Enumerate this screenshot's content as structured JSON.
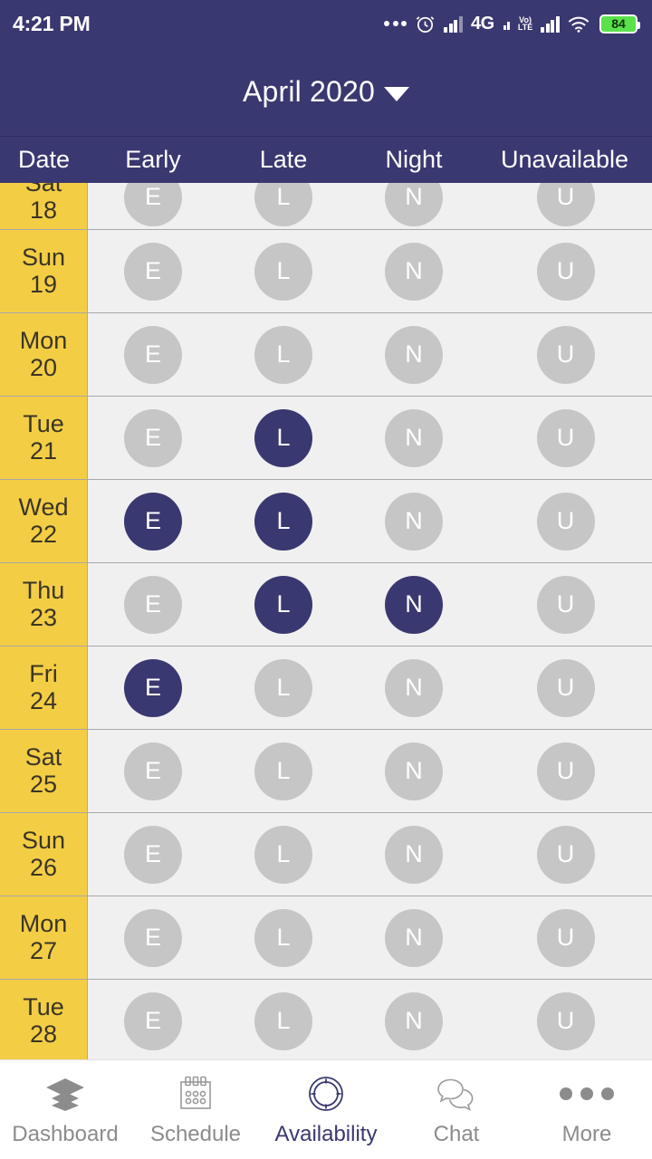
{
  "status_bar": {
    "time": "4:21 PM",
    "icons": [
      "more-dots",
      "alarm-clock",
      "signal-weak",
      "4g",
      "volte",
      "signal-full",
      "wifi",
      "battery"
    ],
    "network_label": "4G",
    "volte_top": "Vo)",
    "volte_bottom": "LTE",
    "battery_percent": "84"
  },
  "title_bar": {
    "month": "April 2020",
    "dropdown_icon": "chevron-down-icon"
  },
  "table": {
    "headers": [
      "Date",
      "Early",
      "Late",
      "Night",
      "Unavailable"
    ],
    "slot_letters": [
      "E",
      "L",
      "N",
      "U"
    ],
    "rows": [
      {
        "dow": "Sat",
        "day": "18",
        "clipped": true,
        "selected": [
          false,
          false,
          false,
          false
        ]
      },
      {
        "dow": "Sun",
        "day": "19",
        "clipped": false,
        "selected": [
          false,
          false,
          false,
          false
        ]
      },
      {
        "dow": "Mon",
        "day": "20",
        "clipped": false,
        "selected": [
          false,
          false,
          false,
          false
        ]
      },
      {
        "dow": "Tue",
        "day": "21",
        "clipped": false,
        "selected": [
          false,
          true,
          false,
          false
        ]
      },
      {
        "dow": "Wed",
        "day": "22",
        "clipped": false,
        "selected": [
          true,
          true,
          false,
          false
        ]
      },
      {
        "dow": "Thu",
        "day": "23",
        "clipped": false,
        "selected": [
          false,
          true,
          true,
          false
        ]
      },
      {
        "dow": "Fri",
        "day": "24",
        "clipped": false,
        "selected": [
          true,
          false,
          false,
          false
        ]
      },
      {
        "dow": "Sat",
        "day": "25",
        "clipped": false,
        "selected": [
          false,
          false,
          false,
          false
        ]
      },
      {
        "dow": "Sun",
        "day": "26",
        "clipped": false,
        "selected": [
          false,
          false,
          false,
          false
        ]
      },
      {
        "dow": "Mon",
        "day": "27",
        "clipped": false,
        "selected": [
          false,
          false,
          false,
          false
        ]
      },
      {
        "dow": "Tue",
        "day": "28",
        "clipped": false,
        "selected": [
          false,
          false,
          false,
          false
        ]
      }
    ]
  },
  "bottom_nav": {
    "active_index": 2,
    "items": [
      {
        "label": "Dashboard",
        "icon": "layers-icon"
      },
      {
        "label": "Schedule",
        "icon": "calendar-icon"
      },
      {
        "label": "Availability",
        "icon": "clock-dial-icon"
      },
      {
        "label": "Chat",
        "icon": "chat-bubbles-icon"
      },
      {
        "label": "More",
        "icon": "ellipsis-icon"
      }
    ]
  },
  "colors": {
    "brand_purple": "#3a3870",
    "date_yellow": "#f3ce45",
    "row_gray": "#f0f0f0",
    "pill_gray": "#c6c6c6",
    "battery_green": "#5ae24a"
  }
}
